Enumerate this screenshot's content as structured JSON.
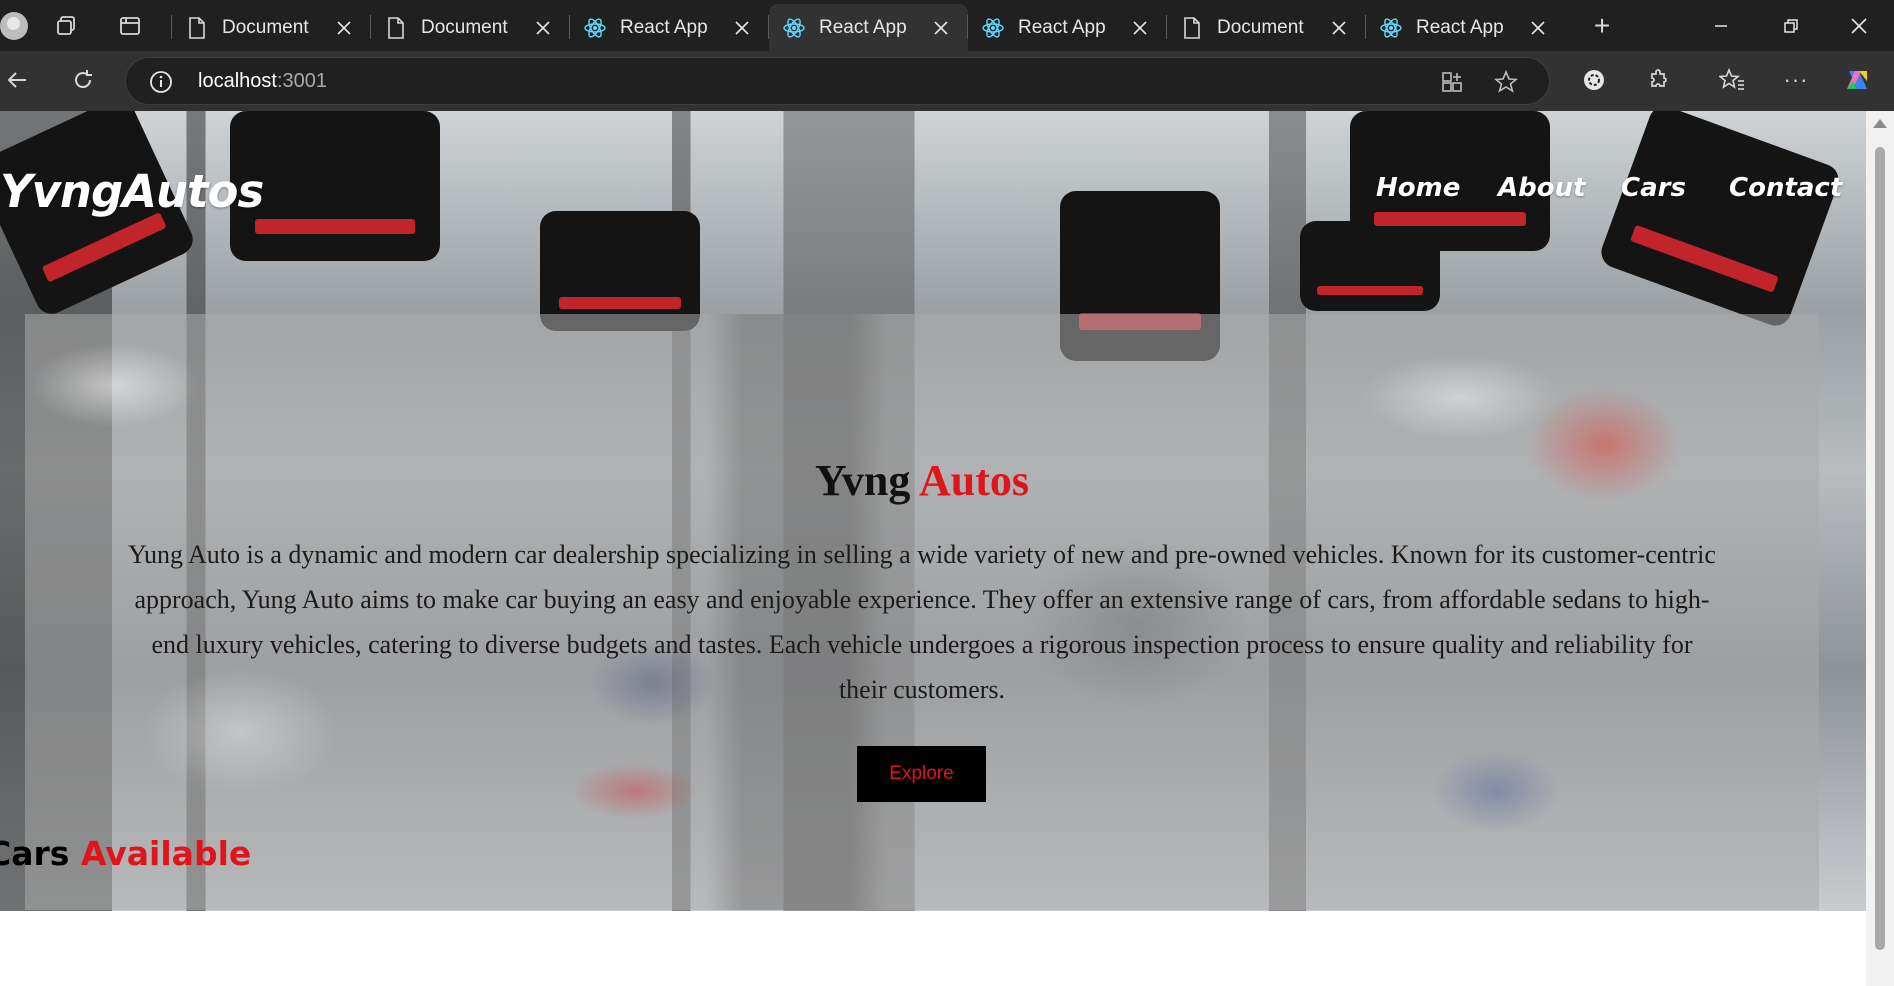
{
  "browser": {
    "tabs": [
      {
        "label": "Document",
        "icon": "document-icon"
      },
      {
        "label": "Document",
        "icon": "document-icon"
      },
      {
        "label": "React App",
        "icon": "react-icon"
      },
      {
        "label": "React App",
        "icon": "react-icon",
        "active": true
      },
      {
        "label": "React App",
        "icon": "react-icon"
      },
      {
        "label": "Document",
        "icon": "document-icon"
      },
      {
        "label": "React App",
        "icon": "react-icon"
      }
    ],
    "url_host": "localhost",
    "url_port": ":3001"
  },
  "nav": {
    "logo": "YvngAutos",
    "links": [
      "Home",
      "About",
      "Cars",
      "Contact"
    ]
  },
  "hero": {
    "title_main": "Yvng",
    "title_accent": "Autos",
    "description": "Yung Auto is a dynamic and modern car dealership specializing in selling a wide variety of new and pre-owned vehicles. Known for its customer-centric approach, Yung Auto aims to make car buying an easy and enjoyable experience. They offer an extensive range of cars, from affordable sedans to high-end luxury vehicles, catering to diverse budgets and tastes. Each vehicle undergoes a rigorous inspection process to ensure quality and reliability for their customers.",
    "button": "Explore"
  },
  "section": {
    "title_main": "Cars",
    "title_accent": "Available"
  },
  "colors": {
    "accent": "#e0141b",
    "chrome_dark": "#202020",
    "chrome_mid": "#323232"
  }
}
